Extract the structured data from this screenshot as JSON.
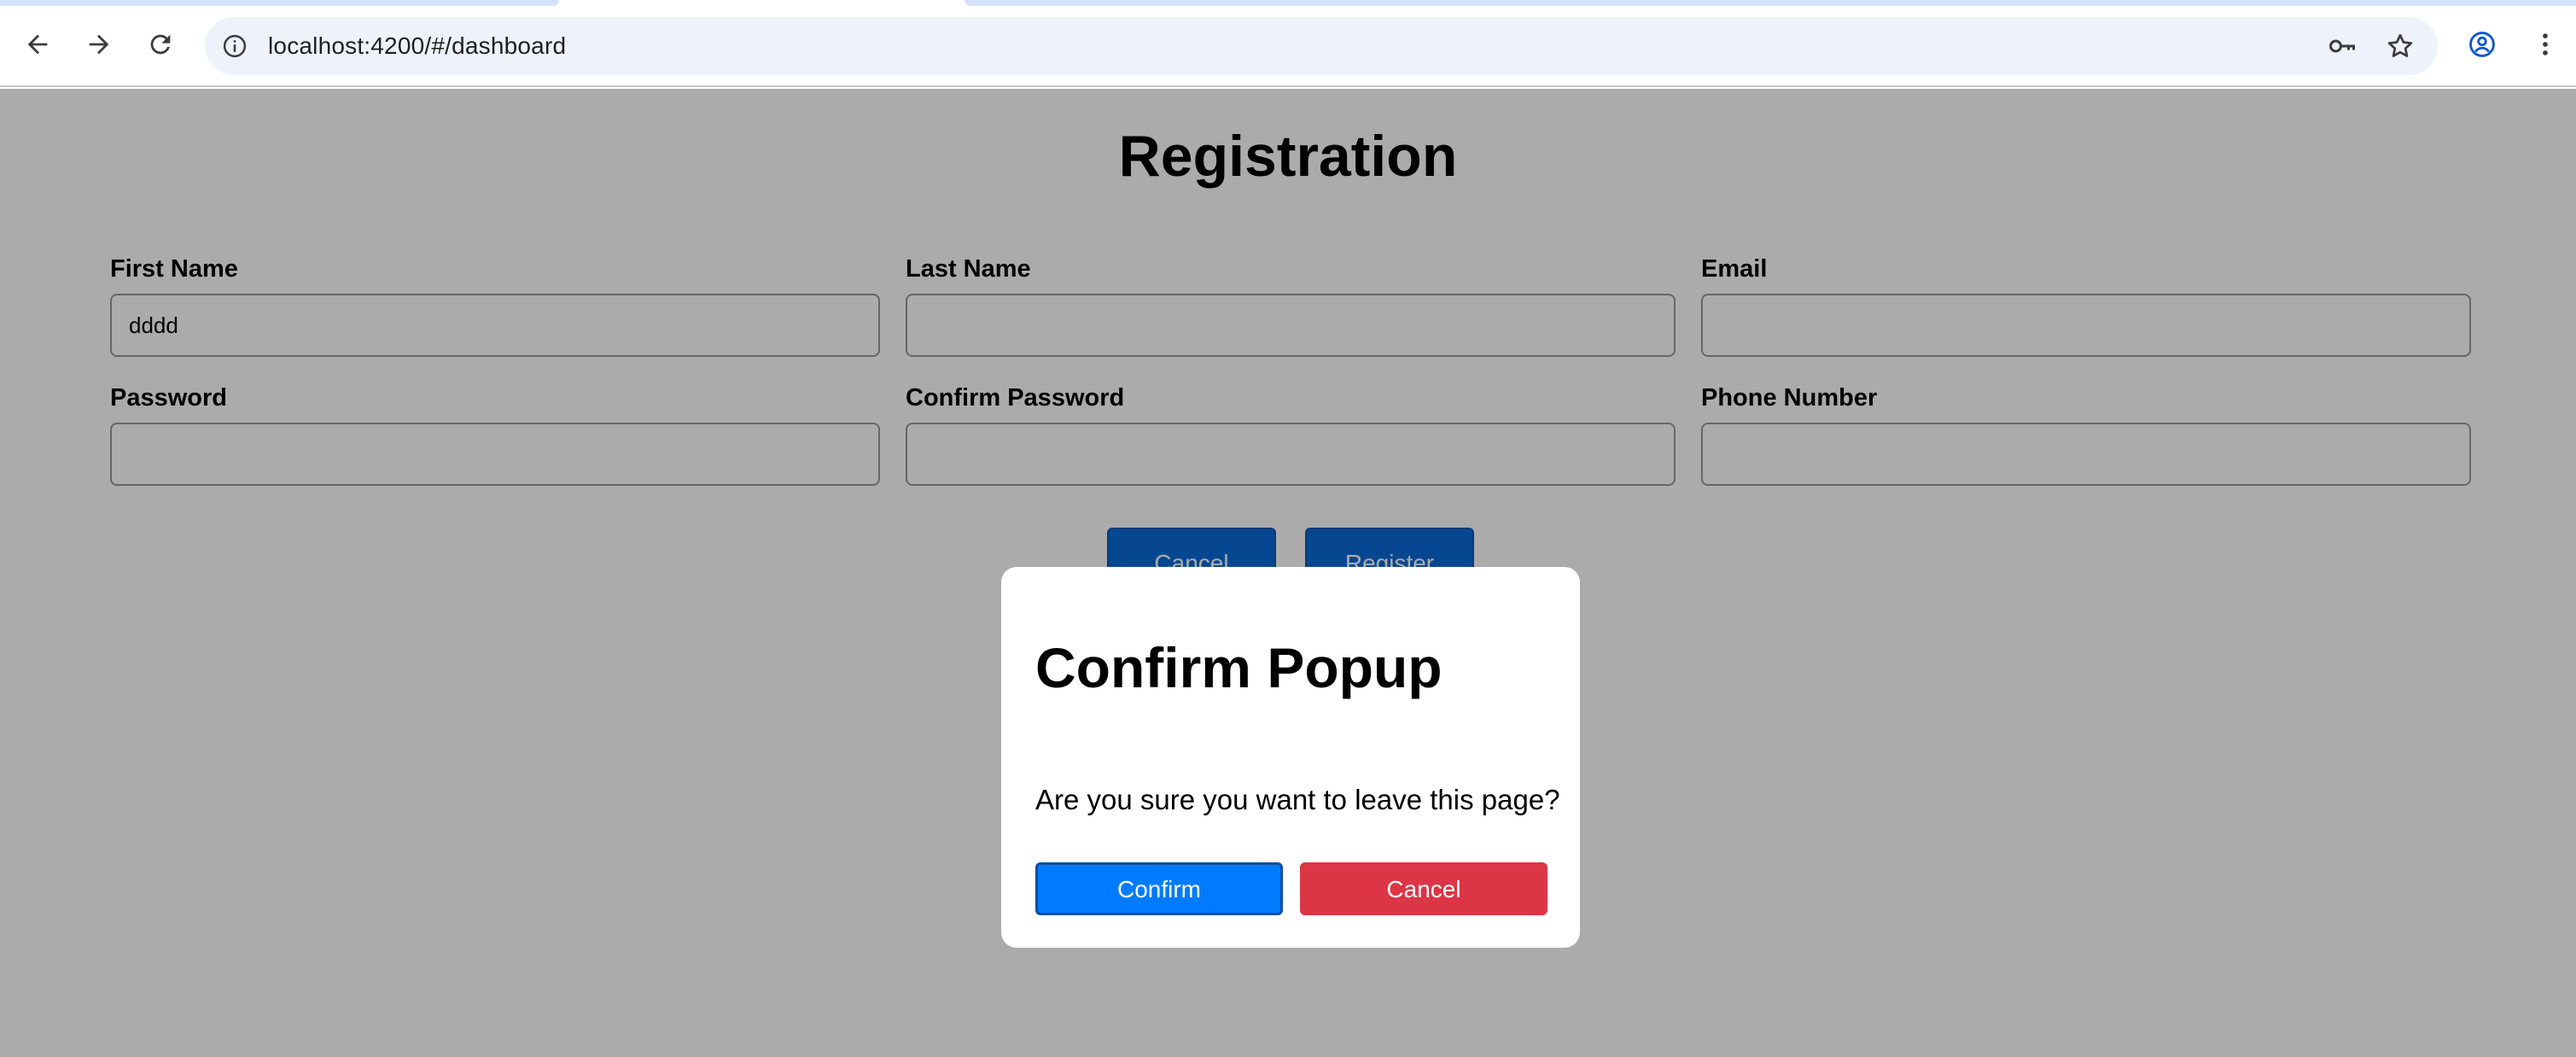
{
  "browser": {
    "url": "localhost:4200/#/dashboard",
    "icons": {
      "back": "arrow-left-icon",
      "forward": "arrow-right-icon",
      "reload": "reload-icon",
      "site_info": "info-icon",
      "passwords": "key-icon",
      "bookmark": "star-icon",
      "profile": "profile-icon",
      "menu": "kebab-menu-icon"
    }
  },
  "page": {
    "title": "Registration",
    "fields": [
      {
        "label": "First Name",
        "value": "dddd",
        "placeholder": ""
      },
      {
        "label": "Last Name",
        "value": "",
        "placeholder": ""
      },
      {
        "label": "Email",
        "value": "",
        "placeholder": ""
      },
      {
        "label": "Password",
        "value": "",
        "placeholder": ""
      },
      {
        "label": "Confirm Password",
        "value": "",
        "placeholder": ""
      },
      {
        "label": "Phone Number",
        "value": "",
        "placeholder": ""
      }
    ],
    "buttons": {
      "cancel": "Cancel",
      "register": "Register"
    }
  },
  "modal": {
    "title": "Confirm Popup",
    "message": "Are you sure you want to leave this page?",
    "confirm_label": "Confirm",
    "cancel_label": "Cancel"
  },
  "colors": {
    "primary": "#0b6bd8",
    "confirm": "#007bff",
    "danger": "#dc3545",
    "overlay": "rgba(0,0,0,0.33)",
    "tab_accent": "#d3e3fd"
  }
}
